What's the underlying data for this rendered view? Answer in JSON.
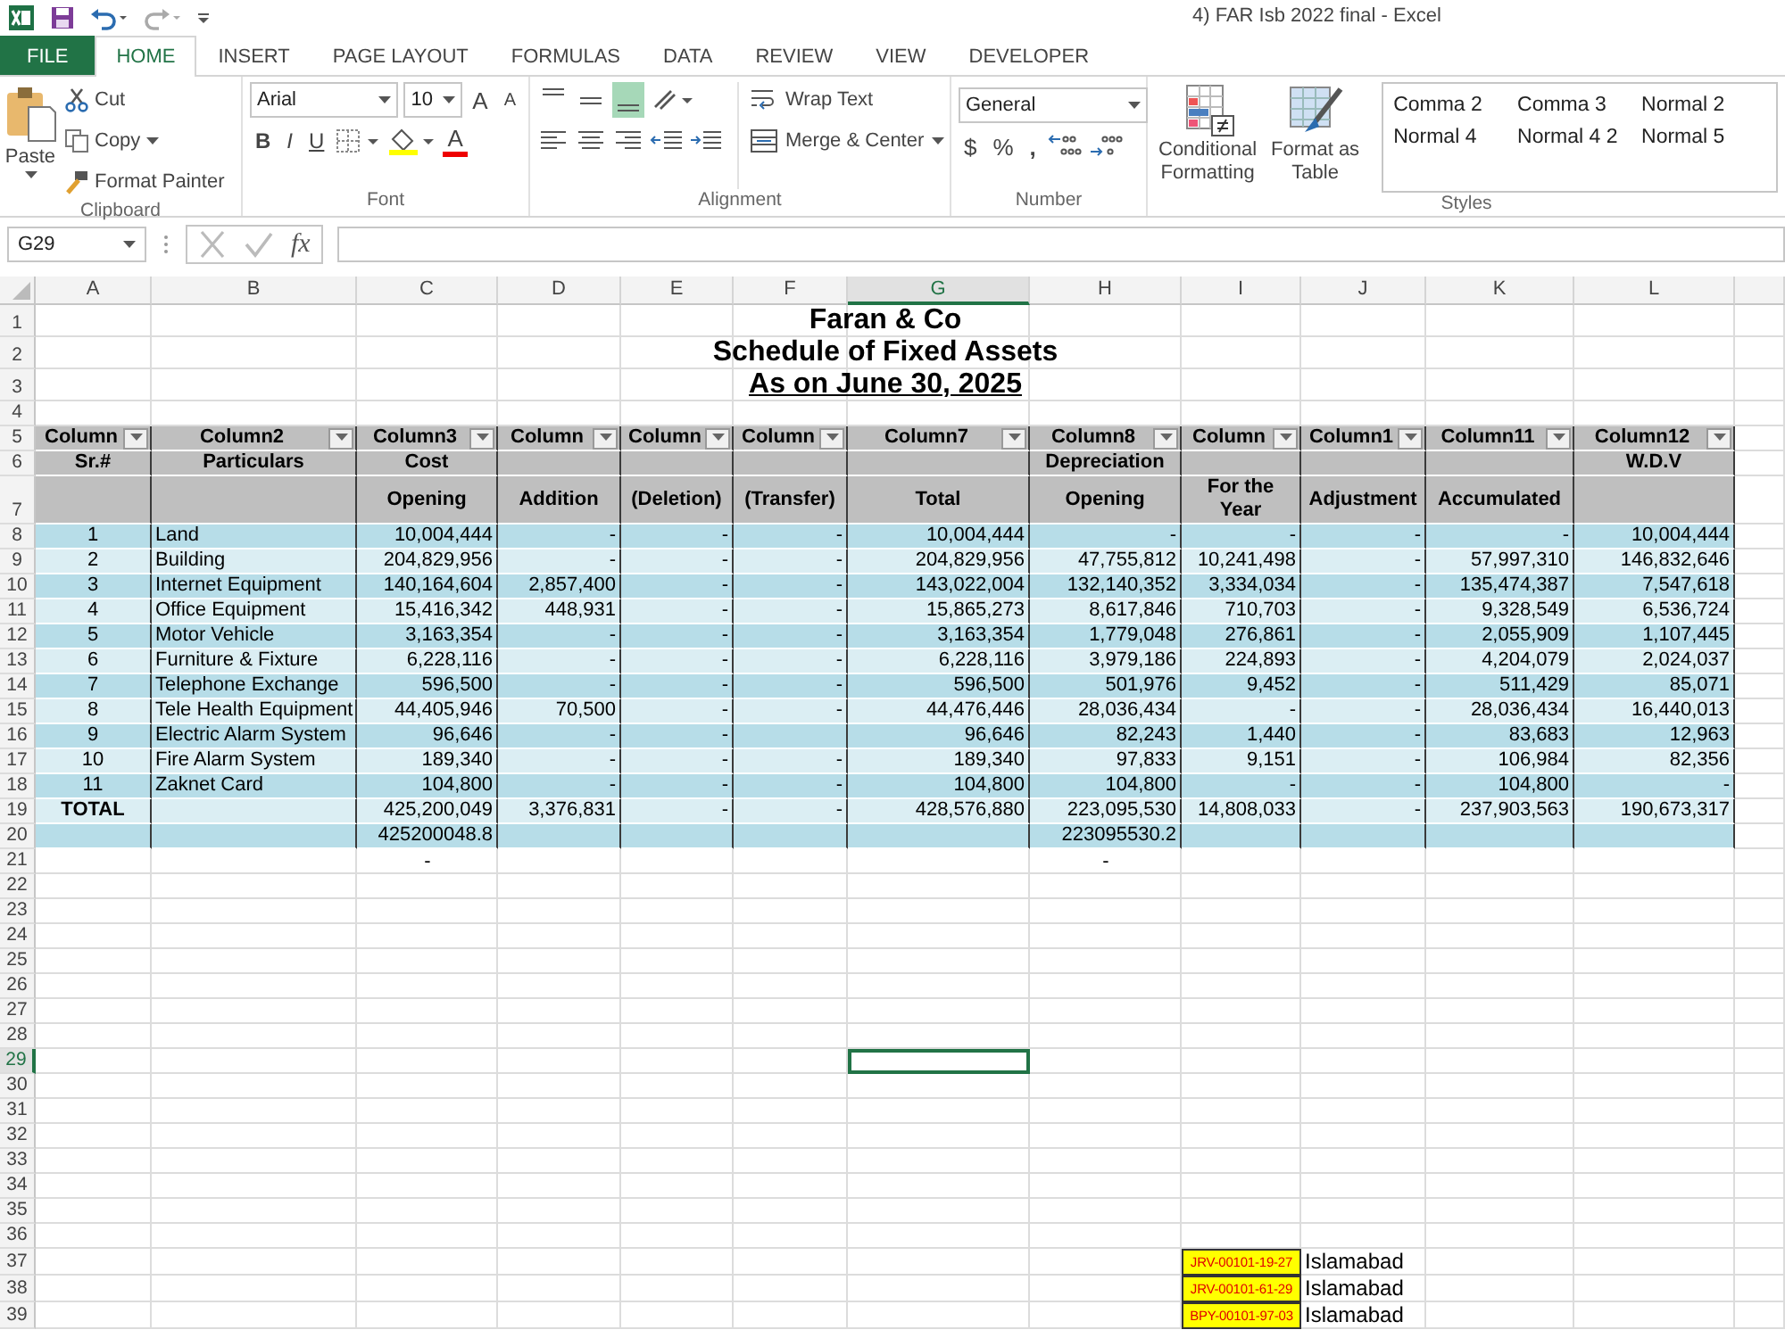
{
  "app": {
    "title": "4) FAR Isb 2022 final - Excel"
  },
  "tabs": [
    {
      "label": "FILE",
      "kind": "file",
      "selected": false
    },
    {
      "label": "HOME",
      "kind": "tab",
      "selected": true
    },
    {
      "label": "INSERT",
      "kind": "tab",
      "selected": false
    },
    {
      "label": "PAGE LAYOUT",
      "kind": "tab",
      "selected": false
    },
    {
      "label": "FORMULAS",
      "kind": "tab",
      "selected": false
    },
    {
      "label": "DATA",
      "kind": "tab",
      "selected": false
    },
    {
      "label": "REVIEW",
      "kind": "tab",
      "selected": false
    },
    {
      "label": "VIEW",
      "kind": "tab",
      "selected": false
    },
    {
      "label": "DEVELOPER",
      "kind": "tab",
      "selected": false
    }
  ],
  "ribbon": {
    "clipboard": {
      "paste": "Paste",
      "cut": "Cut",
      "copy": "Copy",
      "format_painter": "Format Painter",
      "label": "Clipboard"
    },
    "font": {
      "name": "Arial",
      "size": "10",
      "grow": "A",
      "shrink": "A",
      "bold": "B",
      "italic": "I",
      "underline": "U",
      "font_color": "A",
      "label": "Font"
    },
    "alignment": {
      "vertical": [
        {
          "selected": false
        },
        {
          "selected": false
        },
        {
          "selected": true
        }
      ],
      "wrap": "Wrap Text",
      "merge": "Merge & Center",
      "label": "Alignment"
    },
    "number": {
      "format": "General",
      "currency": "$",
      "percent": "%",
      "comma": ",",
      "label": "Number"
    },
    "styles": {
      "conditional": [
        "Conditional",
        "Formatting"
      ],
      "table": [
        "Format as",
        "Table"
      ],
      "gallery": [
        "Comma 2",
        "Comma 3",
        "Normal 2",
        "Normal 4",
        "Normal 4 2",
        "Normal 5"
      ],
      "label": "Styles"
    }
  },
  "formula_bar": {
    "name_box": "G29",
    "function": "fx"
  },
  "sheet": {
    "columns": [
      {
        "letter": "A",
        "selected": false
      },
      {
        "letter": "B",
        "selected": false
      },
      {
        "letter": "C",
        "selected": false
      },
      {
        "letter": "D",
        "selected": false
      },
      {
        "letter": "E",
        "selected": false
      },
      {
        "letter": "F",
        "selected": false
      },
      {
        "letter": "G",
        "selected": true
      },
      {
        "letter": "H",
        "selected": false
      },
      {
        "letter": "I",
        "selected": false
      },
      {
        "letter": "J",
        "selected": false
      },
      {
        "letter": "K",
        "selected": false
      },
      {
        "letter": "L",
        "selected": false
      }
    ],
    "rows": [
      {
        "number": "1",
        "selected": false,
        "kind": "title",
        "cells": [
          "Faran & Co"
        ]
      },
      {
        "number": "2",
        "selected": false,
        "kind": "title",
        "cells": [
          "Schedule of Fixed Assets"
        ]
      },
      {
        "number": "3",
        "selected": false,
        "kind": "subtitle",
        "cells": [
          "As on June 30, 2025"
        ]
      },
      {
        "number": "4",
        "selected": false
      },
      {
        "number": "5",
        "selected": false,
        "kind": "filter",
        "color": "#bfbfbf",
        "cells": [
          "Column",
          "Column2",
          "Column3",
          "Column",
          "Column",
          "Column",
          "Column7",
          "Column8",
          "Column",
          "Column1",
          "Column11",
          "Column12"
        ]
      },
      {
        "number": "6",
        "selected": false,
        "kind": "header",
        "color": "#bfbfbf",
        "cells": [
          "Sr.#",
          "Particulars",
          "Cost",
          null,
          null,
          null,
          null,
          "Depreciation",
          null,
          null,
          null,
          "W.D.V"
        ]
      },
      {
        "number": "7",
        "selected": false,
        "kind": "header",
        "color": "#bfbfbf",
        "cells": [
          null,
          null,
          "Opening",
          "Addition",
          "(Deletion)",
          "(Transfer)",
          "Total",
          "Opening",
          "For the Year",
          "Adjustment",
          "Accumulated",
          null
        ]
      },
      {
        "number": "8",
        "selected": false,
        "kind": "data",
        "color": "#b7dde8",
        "cells": [
          "1",
          "Land",
          "10,004,444",
          "-",
          "-",
          "-",
          "10,004,444",
          "-",
          "-",
          "-",
          "-",
          "10,004,444"
        ]
      },
      {
        "number": "9",
        "selected": false,
        "kind": "data",
        "color": "#dbeef3",
        "cells": [
          "2",
          "Building",
          "204,829,956",
          "-",
          "-",
          "-",
          "204,829,956",
          "47,755,812",
          "10,241,498",
          "-",
          "57,997,310",
          "146,832,646"
        ]
      },
      {
        "number": "10",
        "selected": false,
        "kind": "data",
        "color": "#b7dde8",
        "cells": [
          "3",
          "Internet Equipment",
          "140,164,604",
          "2,857,400",
          "-",
          "-",
          "143,022,004",
          "132,140,352",
          "3,334,034",
          "-",
          "135,474,387",
          "7,547,618"
        ]
      },
      {
        "number": "11",
        "selected": false,
        "kind": "data",
        "color": "#dbeef3",
        "cells": [
          "4",
          "Office Equipment",
          "15,416,342",
          "448,931",
          "-",
          "-",
          "15,865,273",
          "8,617,846",
          "710,703",
          "-",
          "9,328,549",
          "6,536,724"
        ]
      },
      {
        "number": "12",
        "selected": false,
        "kind": "data",
        "color": "#b7dde8",
        "cells": [
          "5",
          "Motor Vehicle",
          "3,163,354",
          "-",
          "-",
          "-",
          "3,163,354",
          "1,779,048",
          "276,861",
          "-",
          "2,055,909",
          "1,107,445"
        ]
      },
      {
        "number": "13",
        "selected": false,
        "kind": "data",
        "color": "#dbeef3",
        "cells": [
          "6",
          "Furniture & Fixture",
          "6,228,116",
          "-",
          "-",
          "-",
          "6,228,116",
          "3,979,186",
          "224,893",
          "-",
          "4,204,079",
          "2,024,037"
        ]
      },
      {
        "number": "14",
        "selected": false,
        "kind": "data",
        "color": "#b7dde8",
        "cells": [
          "7",
          "Telephone Exchange",
          "596,500",
          "-",
          "-",
          "-",
          "596,500",
          "501,976",
          "9,452",
          "-",
          "511,429",
          "85,071"
        ]
      },
      {
        "number": "15",
        "selected": false,
        "kind": "data",
        "color": "#dbeef3",
        "cells": [
          "8",
          "Tele Health Equipment",
          "44,405,946",
          "70,500",
          "-",
          "-",
          "44,476,446",
          "28,036,434",
          "-",
          "-",
          "28,036,434",
          "16,440,013"
        ]
      },
      {
        "number": "16",
        "selected": false,
        "kind": "data",
        "color": "#b7dde8",
        "cells": [
          "9",
          "Electric Alarm System",
          "96,646",
          "-",
          "-",
          null,
          "96,646",
          "82,243",
          "1,440",
          "-",
          "83,683",
          "12,963"
        ]
      },
      {
        "number": "17",
        "selected": false,
        "kind": "data",
        "color": "#dbeef3",
        "cells": [
          "10",
          "Fire Alarm System",
          "189,340",
          "-",
          "-",
          "-",
          "189,340",
          "97,833",
          "9,151",
          "-",
          "106,984",
          "82,356"
        ]
      },
      {
        "number": "18",
        "selected": false,
        "kind": "data",
        "color": "#b7dde8",
        "cells": [
          "11",
          "Zaknet Card",
          "104,800",
          "-",
          "-",
          "-",
          "104,800",
          "104,800",
          "-",
          "-",
          "104,800",
          "-"
        ]
      },
      {
        "number": "19",
        "selected": false,
        "kind": "total",
        "color": "#dbeef3",
        "cells": [
          "TOTAL",
          null,
          "425,200,049",
          "3,376,831",
          "-",
          "-",
          "428,576,880",
          "223,095,530",
          "14,808,033",
          "-",
          "237,903,563",
          "190,673,317"
        ]
      },
      {
        "number": "20",
        "selected": false,
        "kind": "data",
        "color": "#b7dde8",
        "cells": [
          null,
          null,
          "425200048.8",
          null,
          null,
          null,
          null,
          "223095530.2"
        ]
      },
      {
        "number": "21",
        "selected": false,
        "kind": "plain",
        "cells": [
          null,
          null,
          "-",
          null,
          null,
          null,
          null,
          "-"
        ]
      },
      {
        "number": "22",
        "selected": false
      },
      {
        "number": "23",
        "selected": false
      },
      {
        "number": "24",
        "selected": false
      },
      {
        "number": "25",
        "selected": false
      },
      {
        "number": "26",
        "selected": false
      },
      {
        "number": "27",
        "selected": false
      },
      {
        "number": "28",
        "selected": false
      },
      {
        "number": "29",
        "selected": true
      },
      {
        "number": "30",
        "selected": false
      },
      {
        "number": "31",
        "selected": false
      },
      {
        "number": "32",
        "selected": false
      },
      {
        "number": "33",
        "selected": false
      },
      {
        "number": "34",
        "selected": false
      },
      {
        "number": "35",
        "selected": false
      },
      {
        "number": "36",
        "selected": false
      },
      {
        "number": "37",
        "selected": false,
        "kind": "note",
        "color": "#ffff00",
        "cells": [
          null,
          null,
          null,
          null,
          null,
          null,
          null,
          null,
          "JRV-00101-19-27",
          "Islamabad"
        ]
      },
      {
        "number": "38",
        "selected": false,
        "kind": "note",
        "color": "#ffff00",
        "cells": [
          null,
          null,
          null,
          null,
          null,
          null,
          null,
          null,
          "JRV-00101-61-29",
          "Islamabad"
        ]
      },
      {
        "number": "39",
        "selected": false,
        "kind": "note",
        "color": "#ffff00",
        "cells": [
          null,
          null,
          null,
          null,
          null,
          null,
          null,
          null,
          "BPY-00101-97-03",
          "Islamabad"
        ]
      }
    ]
  }
}
